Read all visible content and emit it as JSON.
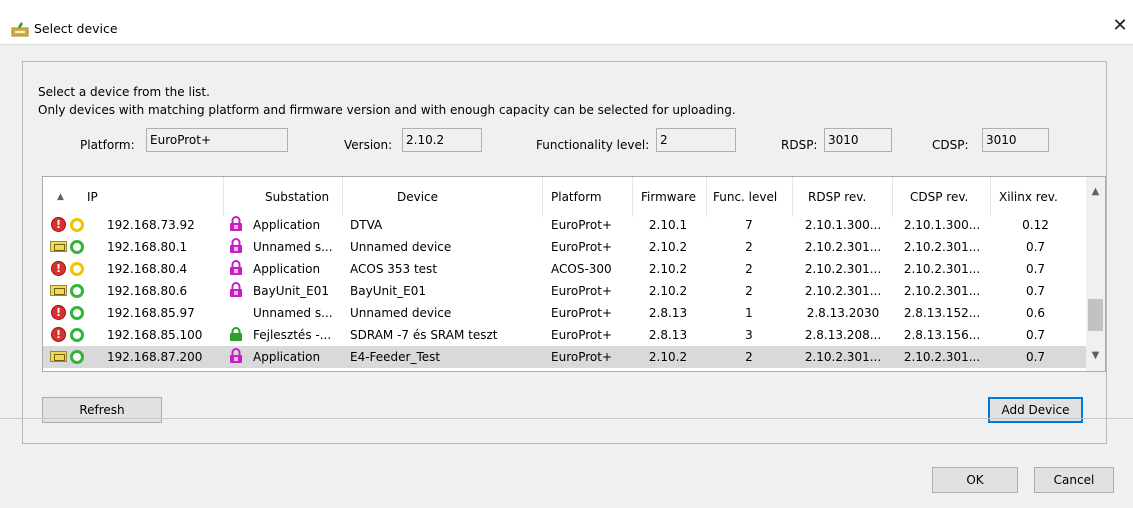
{
  "window": {
    "title": "Select device",
    "close_glyph": "✕"
  },
  "intro": {
    "line1": "Select a device from the list.",
    "line2": "Only devices with matching platform and firmware version and with enough capacity can be selected for uploading."
  },
  "fields": {
    "platform_label": "Platform:",
    "platform_value": "EuroProt+",
    "version_label": "Version:",
    "version_value": "2.10.2",
    "func_label": "Functionality level:",
    "func_value": "2",
    "rdsp_label": "RDSP:",
    "rdsp_value": "3010",
    "cdsp_label": "CDSP:",
    "cdsp_value": "3010"
  },
  "table": {
    "sort_indicator": "▲",
    "headers": {
      "ip": "IP",
      "substation": "Substation",
      "device": "Device",
      "platform": "Platform",
      "firmware": "Firmware",
      "func": "Func. level",
      "rdsp": "RDSP rev.",
      "cdsp": "CDSP rev.",
      "xilinx": "Xilinx rev."
    },
    "rows": [
      {
        "status": "error",
        "conn": "yellow",
        "lock": "magenta",
        "ip": "192.168.73.92",
        "substation": "Application",
        "device": "DTVA",
        "platform": "EuroProt+",
        "firmware": "2.10.1",
        "func": "7",
        "rdsp": "2.10.1.300...",
        "cdsp": "2.10.1.300...",
        "xilinx": "0.12"
      },
      {
        "status": "module",
        "conn": "green",
        "lock": "magenta",
        "ip": "192.168.80.1",
        "substation": "Unnamed s...",
        "device": "Unnamed device",
        "platform": "EuroProt+",
        "firmware": "2.10.2",
        "func": "2",
        "rdsp": "2.10.2.301...",
        "cdsp": "2.10.2.301...",
        "xilinx": "0.7"
      },
      {
        "status": "error",
        "conn": "yellow",
        "lock": "magenta",
        "ip": "192.168.80.4",
        "substation": "Application",
        "device": "ACOS 353 test",
        "platform": "ACOS-300",
        "firmware": "2.10.2",
        "func": "2",
        "rdsp": "2.10.2.301...",
        "cdsp": "2.10.2.301...",
        "xilinx": "0.7"
      },
      {
        "status": "module",
        "conn": "green",
        "lock": "magenta",
        "ip": "192.168.80.6",
        "substation": "BayUnit_E01",
        "device": "BayUnit_E01",
        "platform": "EuroProt+",
        "firmware": "2.10.2",
        "func": "2",
        "rdsp": "2.10.2.301...",
        "cdsp": "2.10.2.301...",
        "xilinx": "0.7"
      },
      {
        "status": "error",
        "conn": "green",
        "lock": "none",
        "ip": "192.168.85.97",
        "substation": "Unnamed s...",
        "device": "Unnamed device",
        "platform": "EuroProt+",
        "firmware": "2.8.13",
        "func": "1",
        "rdsp": "2.8.13.2030",
        "cdsp": "2.8.13.152...",
        "xilinx": "0.6"
      },
      {
        "status": "error",
        "conn": "green",
        "lock": "green",
        "ip": "192.168.85.100",
        "substation": "Fejlesztés -...",
        "device": "SDRAM -7 és SRAM teszt",
        "platform": "EuroProt+",
        "firmware": "2.8.13",
        "func": "3",
        "rdsp": "2.8.13.208...",
        "cdsp": "2.8.13.156...",
        "xilinx": "0.7"
      },
      {
        "status": "module",
        "conn": "green",
        "lock": "magenta",
        "ip": "192.168.87.200",
        "substation": "Application",
        "device": "E4-Feeder_Test",
        "platform": "EuroProt+",
        "firmware": "2.10.2",
        "func": "2",
        "rdsp": "2.10.2.301...",
        "cdsp": "2.10.2.301...",
        "xilinx": "0.7",
        "selected": true
      }
    ]
  },
  "buttons": {
    "refresh": "Refresh",
    "add_device": "Add Device",
    "ok": "OK",
    "cancel": "Cancel"
  },
  "colors": {
    "accent": "#0078d7",
    "error": "#d8312f",
    "ok_ring": "#34b33a",
    "warn_ring": "#f2c200",
    "lock_magenta": "#c420c4",
    "lock_green": "#2e9e2e"
  }
}
